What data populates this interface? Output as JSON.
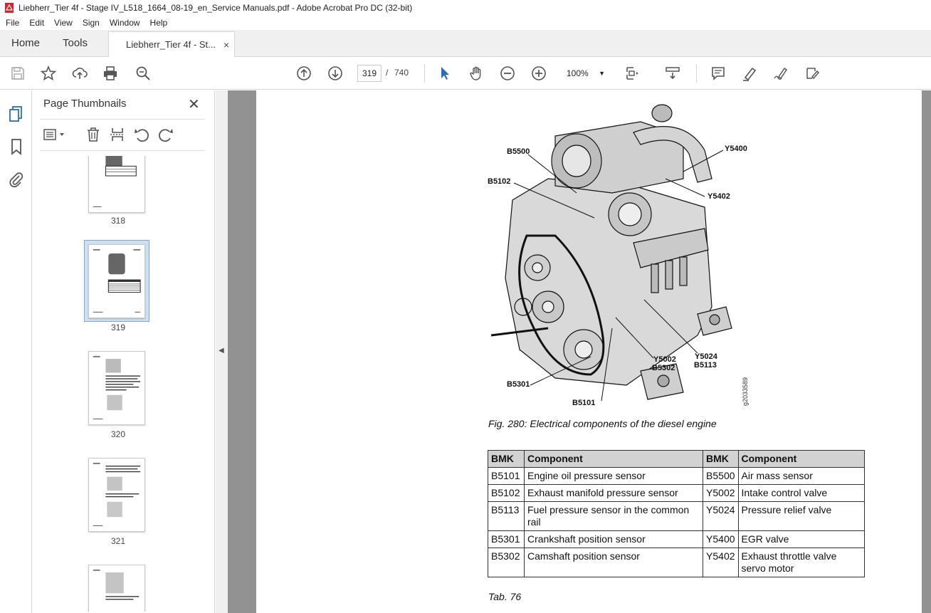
{
  "window": {
    "title": "Liebherr_Tier 4f - Stage IV_L518_1664_08-19_en_Service Manuals.pdf - Adobe Acrobat Pro DC (32-bit)"
  },
  "menu": [
    "File",
    "Edit",
    "View",
    "Sign",
    "Window",
    "Help"
  ],
  "tabs": {
    "home": "Home",
    "tools": "Tools",
    "document": "Liebherr_Tier 4f - St...",
    "close": "×"
  },
  "toolbar": {
    "current_page": "319",
    "separator": "/",
    "total_pages": "740",
    "zoom": "100%",
    "icons": [
      "save-icon",
      "star-icon",
      "upload-icon",
      "print-icon",
      "zoom-search-icon",
      "page-up-icon",
      "page-down-icon",
      "select-arrow-icon",
      "hand-icon",
      "zoom-out-icon",
      "zoom-in-icon",
      "fit-page-icon",
      "scroll-mode-icon",
      "comment-icon",
      "highlight-icon",
      "sign-icon",
      "fill-sign-icon"
    ]
  },
  "thumbnails_panel": {
    "title": "Page Thumbnails",
    "close": "✕",
    "pages": [
      {
        "label": "318",
        "selected": false
      },
      {
        "label": "319",
        "selected": true
      },
      {
        "label": "320",
        "selected": false
      },
      {
        "label": "321",
        "selected": false
      },
      {
        "label": "",
        "selected": false
      }
    ]
  },
  "document": {
    "callouts": [
      "B5500",
      "B5102",
      "Y5400",
      "Y5402",
      "Y5002",
      "B5302",
      "Y5024",
      "B5113",
      "B5301",
      "B5101"
    ],
    "drawing_id": "g2033589",
    "figure_caption": "Fig. 280: Electrical components of the diesel engine",
    "table": {
      "headers": [
        "BMK",
        "Component",
        "BMK",
        "Component"
      ],
      "rows": [
        [
          "B5101",
          "Engine oil pressure sensor",
          "B5500",
          "Air mass sensor"
        ],
        [
          "B5102",
          "Exhaust manifold pressure sensor",
          "Y5002",
          "Intake control valve"
        ],
        [
          "B5113",
          "Fuel pressure sensor in the common rail",
          "Y5024",
          "Pressure relief valve"
        ],
        [
          "B5301",
          "Crankshaft position sensor",
          "Y5400",
          "EGR valve"
        ],
        [
          "B5302",
          "Camshaft position sensor",
          "Y5402",
          "Exhaust throttle valve servo motor"
        ]
      ]
    },
    "table_caption": "Tab. 76"
  }
}
